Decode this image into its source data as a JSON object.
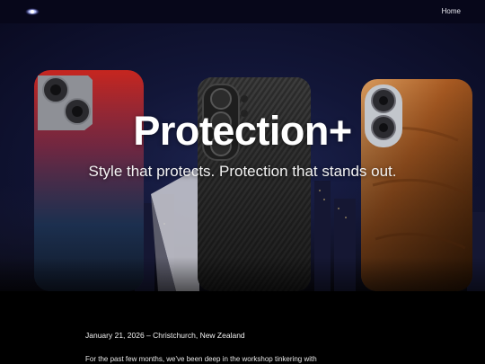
{
  "nav": {
    "home_label": "Home",
    "logo_icon": "eye-orb-logo-icon"
  },
  "hero": {
    "title": "Protection+",
    "subtitle": "Style that protects. Protection that stands out.",
    "cases": [
      {
        "name": "red-blue-gradient-case",
        "colors": [
          "#c02a22",
          "#2a4a78"
        ]
      },
      {
        "name": "carbon-fiber-case",
        "colors": [
          "#3a3a3a",
          "#1a1a1a"
        ]
      },
      {
        "name": "wood-grain-case",
        "colors": [
          "#b36a2c",
          "#6a3310"
        ]
      }
    ]
  },
  "article": {
    "dateline": "January 21, 2026 – Christchurch, New Zealand",
    "first_line": "For the past few months, we've been deep in the workshop tinkering with"
  }
}
